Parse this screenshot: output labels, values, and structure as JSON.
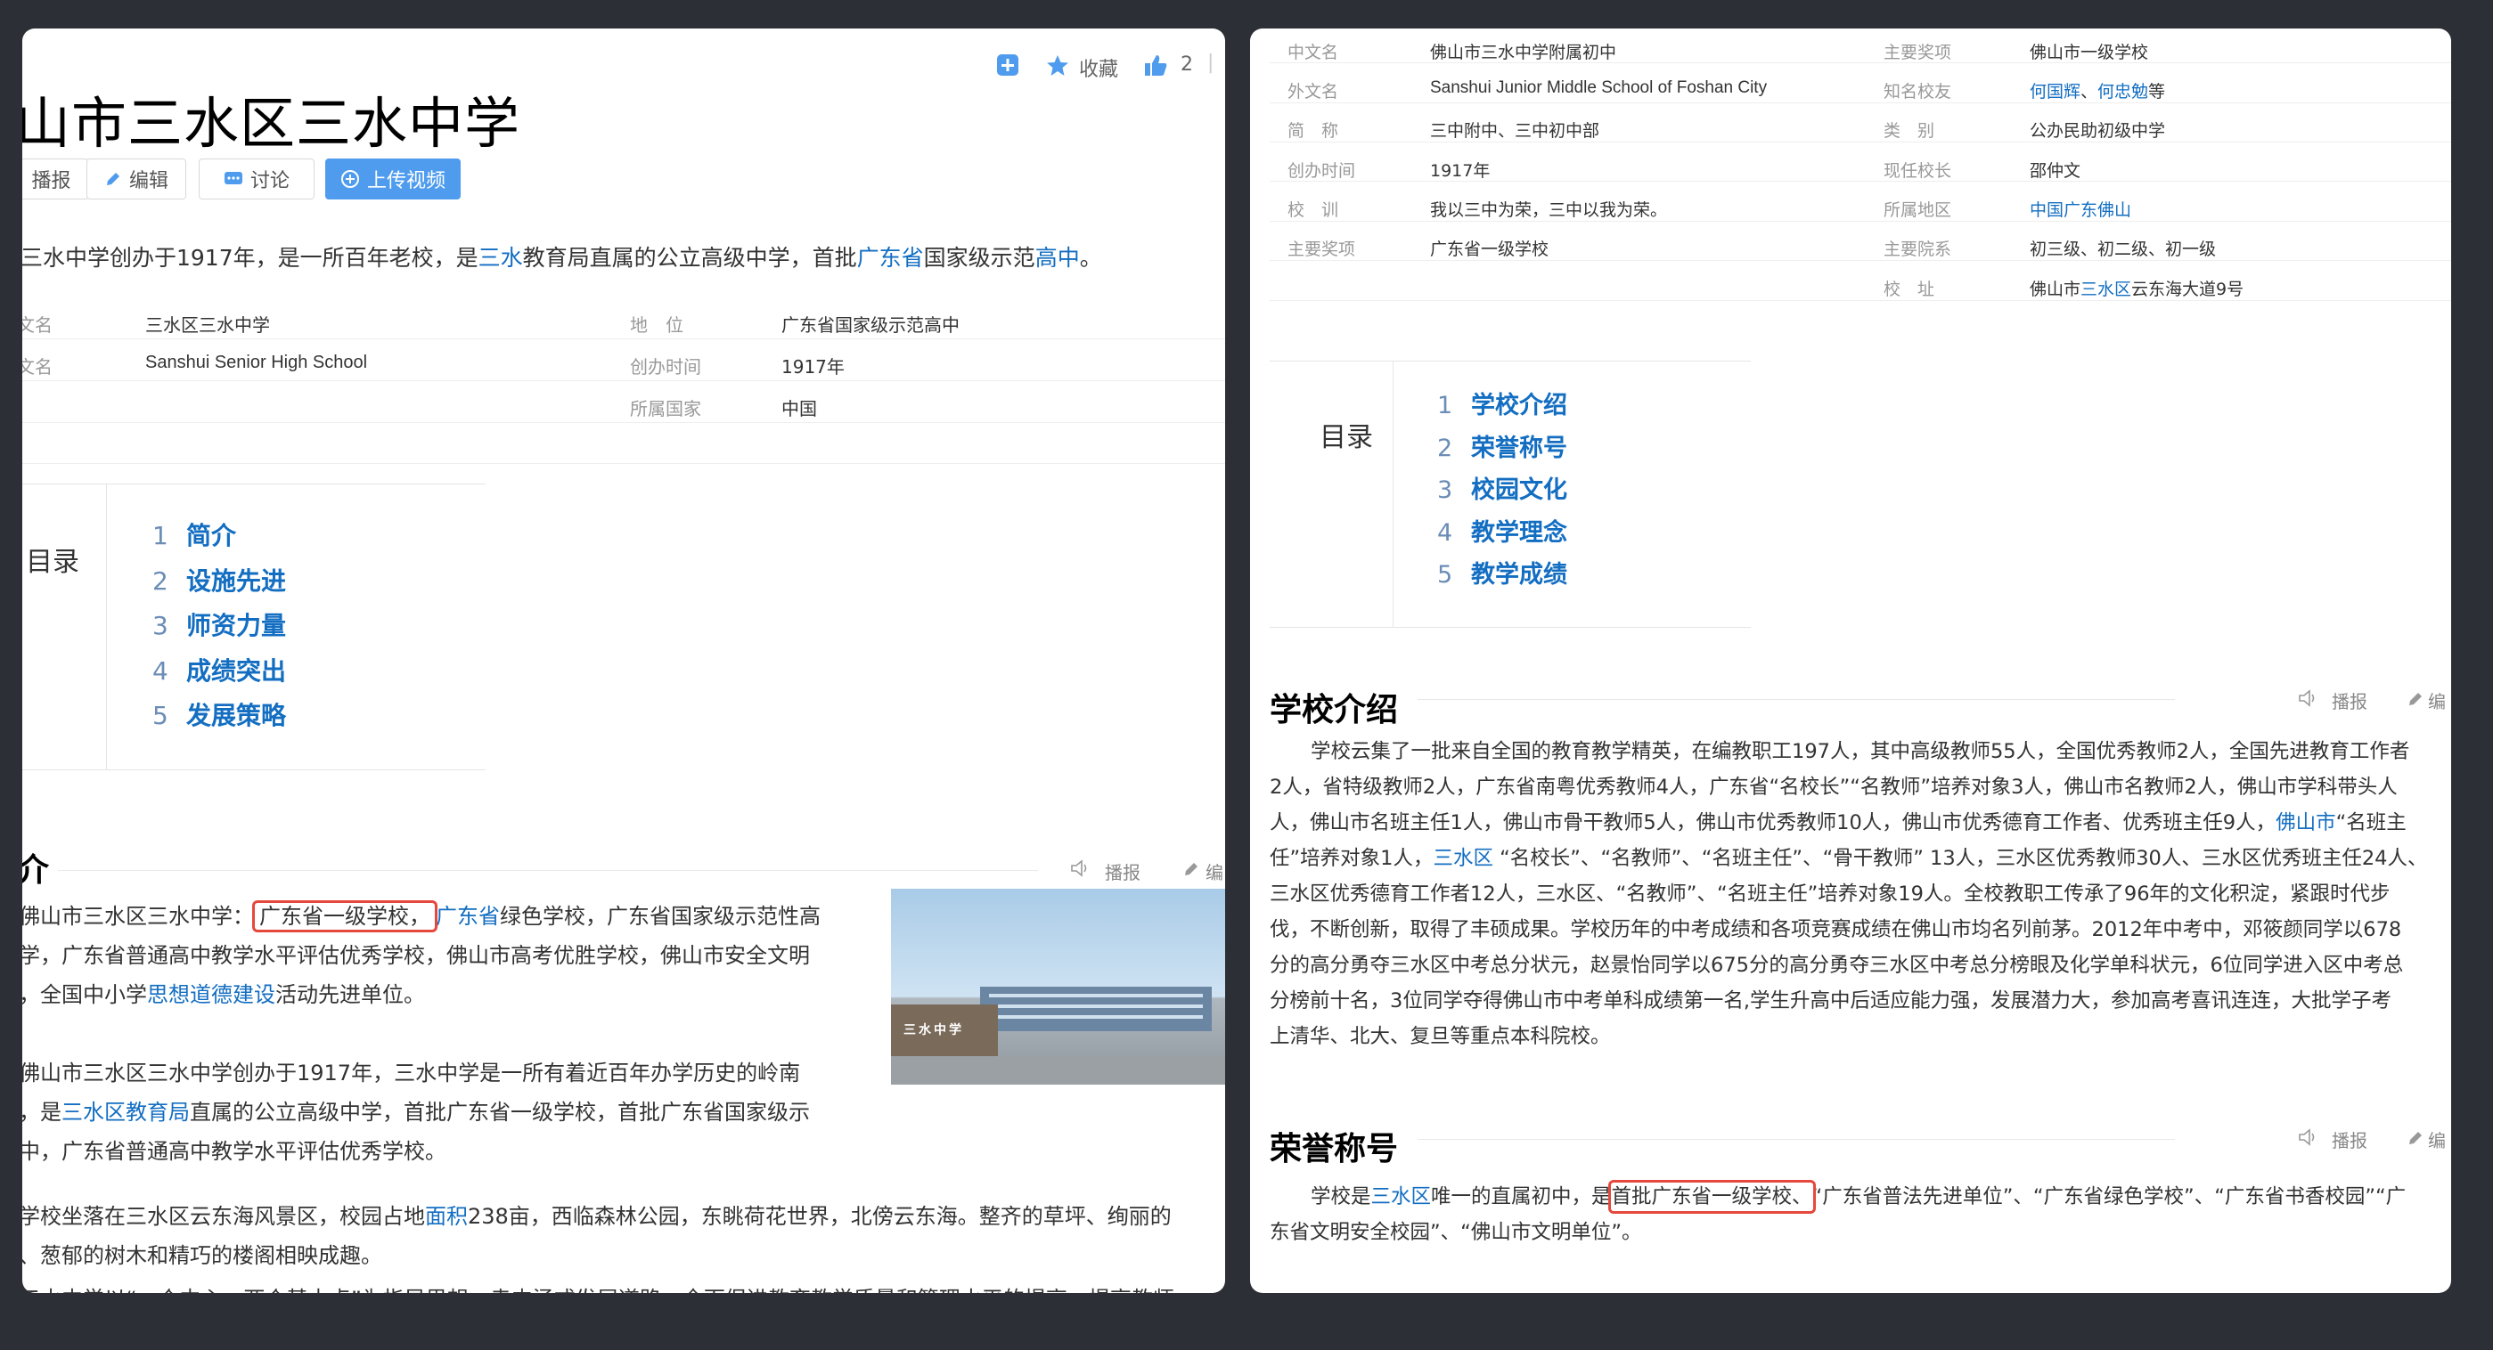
{
  "left": {
    "title": "山市三水区三水中学",
    "action_icons": {
      "add": "plus-square-icon",
      "favorite": "star-icon",
      "like": "thumbs-up-icon"
    },
    "favorite_label": "收藏",
    "like_count": "2",
    "like_sep": "|",
    "buttons": {
      "broadcast": "播报",
      "edit": "编辑",
      "discuss": "讨论",
      "upload": "上传视频"
    },
    "summary": [
      "三水中学创办于1917年，是一所百年老校，是",
      "三水",
      "教育局直属的公立高级中学，首批",
      "广东省",
      "国家级示范",
      "高中",
      "。"
    ],
    "infobox": [
      {
        "k": "文名",
        "v": "三水区三水中学",
        "k2": "地　位",
        "v2": "广东省国家级示范高中"
      },
      {
        "k": "文名",
        "v": "Sanshui Senior High School",
        "k2": "创办时间",
        "v2": "1917年"
      },
      {
        "k": "",
        "v": "",
        "k2": "所属国家",
        "v2": "中国"
      }
    ],
    "toc_label": "目录",
    "toc": [
      {
        "n": "1",
        "t": "简介"
      },
      {
        "n": "2",
        "t": "设施先进"
      },
      {
        "n": "3",
        "t": "师资力量"
      },
      {
        "n": "4",
        "t": "成绩突出"
      },
      {
        "n": "5",
        "t": "发展策略"
      }
    ],
    "section_title": "介",
    "section_actions": {
      "broadcast": "播报",
      "edit": "编"
    },
    "p1": {
      "pre": "佛山市三水区三水中学：",
      "boxed": "广东省一级学校，",
      "link": "广东省",
      "post": "绿色学校，广东省国家级示范性高",
      "line2": "学，广东省普通高中教学水平评估优秀学校，佛山市高考优胜学校，佛山市安全文明",
      "line3_pre": "，全国中小学",
      "line3_link": "思想道德建设",
      "line3_post": "活动先进单位。"
    },
    "p2": {
      "line1": "佛山市三水区三水中学创办于1917年，三水中学是一所有着近百年办学历史的岭南",
      "line2_pre": "，是",
      "line2_link": "三水区教育局",
      "line2_post": "直属的公立高级中学，首批广东省一级学校，首批广东省国家级示",
      "line3": "中，广东省普通高中教学水平评估优秀学校。"
    },
    "p3": {
      "line1_pre": "学校坐落在三水区云东海风景区，校园占地",
      "line1_link": "面积",
      "line1_post": "238亩，西临森林公园，东眺荷花世界，北傍云东海。整齐的草坪、绚丽的",
      "line2": "、葱郁的树木和精巧的楼阁相映成趣。"
    },
    "p4": "三水中学以“一个中心、两个基本点”为指导思想，走内涵式发展道路，全面促进教育教学质量和管理水平的提高，提高教师",
    "photo_sign": "三水中学"
  },
  "right": {
    "infobox": [
      {
        "k": "中文名",
        "v": "佛山市三水中学附属初中",
        "k2": "主要奖项",
        "v2": "佛山市一级学校"
      },
      {
        "k": "外文名",
        "v": "Sanshui Junior Middle School of Foshan City",
        "k2": "知名校友",
        "v2": "何国辉、何忠勉等"
      },
      {
        "k": "简　称",
        "v": "三中附中、三中初中部",
        "k2": "类　别",
        "v2": "公办民助初级中学"
      },
      {
        "k": "创办时间",
        "v": "1917年",
        "k2": "现任校长",
        "v2": "邵仲文"
      },
      {
        "k": "校　训",
        "v": "我以三中为荣，三中以我为荣。",
        "k2": "所属地区",
        "v2": "中国广东佛山"
      },
      {
        "k": "主要奖项",
        "v": "广东省一级学校",
        "k2": "主要院系",
        "v2": "初三级、初二级、初一级"
      },
      {
        "k": "",
        "v": "",
        "k2": "校　址",
        "v2": "佛山市三水区云东海大道9号"
      }
    ],
    "alumni": [
      "何国辉",
      "何忠勉",
      "等"
    ],
    "region": "中国广东佛山",
    "address": [
      "佛山市",
      "三水区",
      "云东海大道9号"
    ],
    "toc_label": "目录",
    "toc": [
      {
        "n": "1",
        "t": "学校介绍"
      },
      {
        "n": "2",
        "t": "荣誉称号"
      },
      {
        "n": "3",
        "t": "校园文化"
      },
      {
        "n": "4",
        "t": "教学理念"
      },
      {
        "n": "5",
        "t": "教学成绩"
      }
    ],
    "s1_title": "学校介绍",
    "s1_lines": [
      "学校云集了一批来自全国的教育教学精英，在编教职工197人，其中高级教师55人，全国优秀教师2人，全国先进教育工作者",
      "2人，省特级教师2人，广东省南粤优秀教师4人，广东省“名校长”“名教师”培养对象3人，佛山市名教师2人，佛山市学科带头人",
      "人，佛山市名班主任1人，佛山市骨干教师5人，佛山市优秀教师10人，佛山市优秀德育工作者、优秀班主任9人，",
      "任”培养对象1人，",
      "三水区优秀德育工作者12人，三水区、“名教师”、“名班主任”培养对象19人。全校教职工传承了96年的文化积淀，紧跟时代步",
      "伐，不断创新，取得了丰硕成果。学校历年的中考成绩和各项竞赛成绩在佛山市均名列前茅。2012年中考中，邓筱颜同学以678",
      "分的高分勇夺三水区中考总分状元，赵景怡同学以675分的高分勇夺三水区中考总分榜眼及化学单科状元，6位同学进入区中考总",
      "分榜前十名，3位同学夺得佛山市中考单科成绩第一名,学生升高中后适应能力强，发展潜力大，参加高考喜讯连连，大批学子考",
      "上清华、北大、复旦等重点本科院校。"
    ],
    "s1_l3_link": "佛山市",
    "s1_l3_post": "“名班主",
    "s1_l4_link": "三水区",
    "s1_l4_post": " “名校长”、“名教师”、“名班主任”、“骨干教师” 13人，三水区优秀教师30人、三水区优秀班主任24人、",
    "s2_title": "荣誉称号",
    "s2": {
      "pre": "学校是",
      "link": "三水区",
      "mid": "唯一的直属初中，是",
      "boxed": "首批广东省一级学校、",
      "post": "“广东省普法先进单位”、“广东省绿色学校”、“广东省书香校园”“广",
      "line2": "东省文明安全校园”、“佛山市文明单位”。"
    },
    "section_actions": {
      "broadcast": "播报",
      "edit": "编"
    }
  },
  "colors": {
    "link": "#136ec2",
    "highlight_box": "#e5483d",
    "button_primary": "#4f9cee",
    "background": "#2c2f36"
  }
}
